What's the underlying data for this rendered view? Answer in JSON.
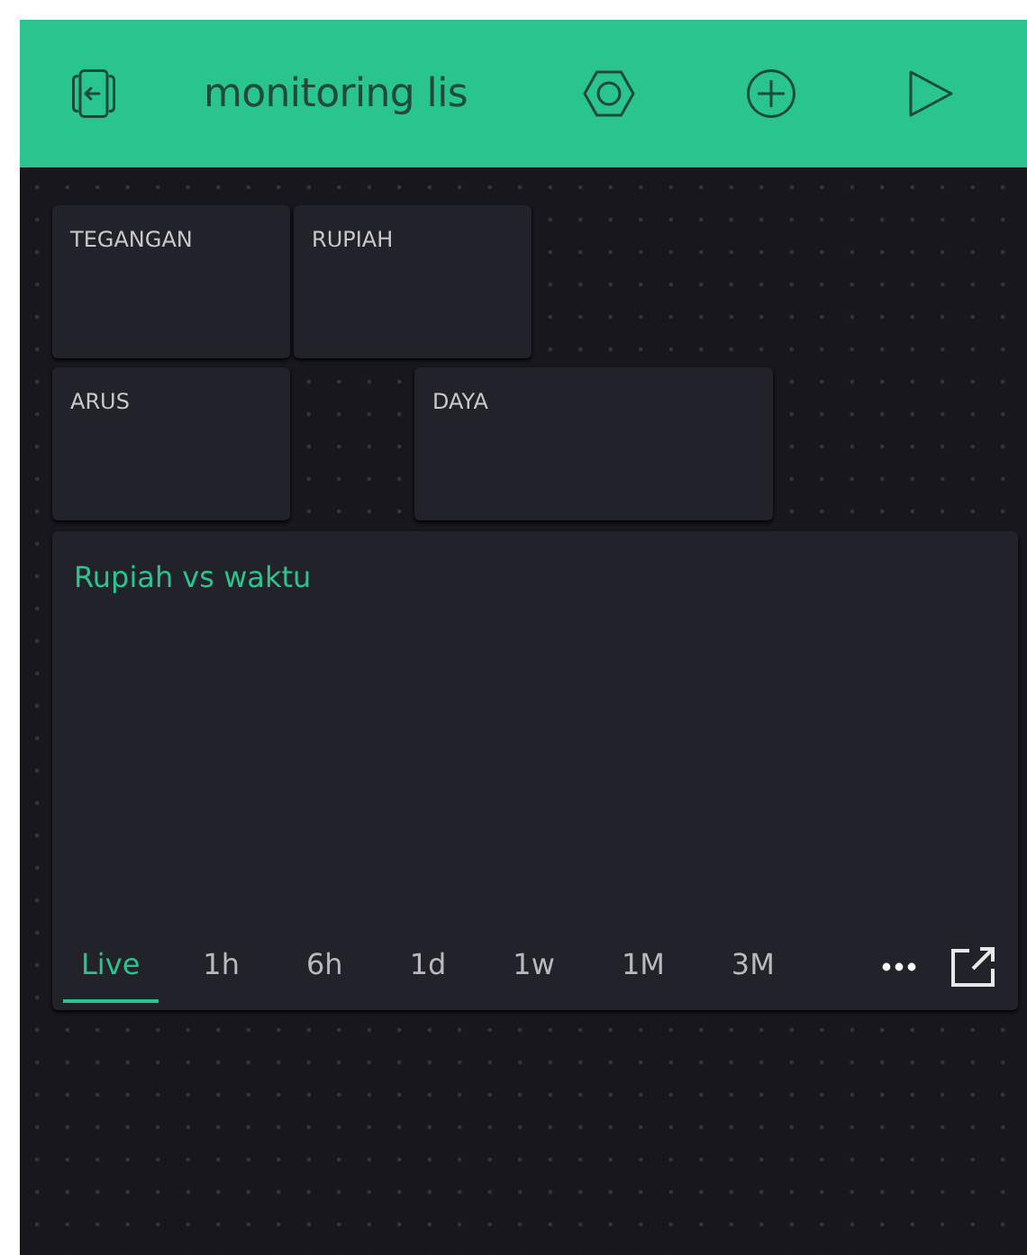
{
  "header": {
    "title": "monitoring lis"
  },
  "widgets": [
    {
      "label": "TEGANGAN"
    },
    {
      "label": "RUPIAH"
    },
    {
      "label": "ARUS"
    },
    {
      "label": "DAYA"
    }
  ],
  "chart": {
    "title": "Rupiah vs waktu",
    "ranges": [
      {
        "label": "Live",
        "selected": true
      },
      {
        "label": "1h",
        "selected": false
      },
      {
        "label": "6h",
        "selected": false
      },
      {
        "label": "1d",
        "selected": false
      },
      {
        "label": "1w",
        "selected": false
      },
      {
        "label": "1M",
        "selected": false
      },
      {
        "label": "3M",
        "selected": false
      }
    ]
  }
}
